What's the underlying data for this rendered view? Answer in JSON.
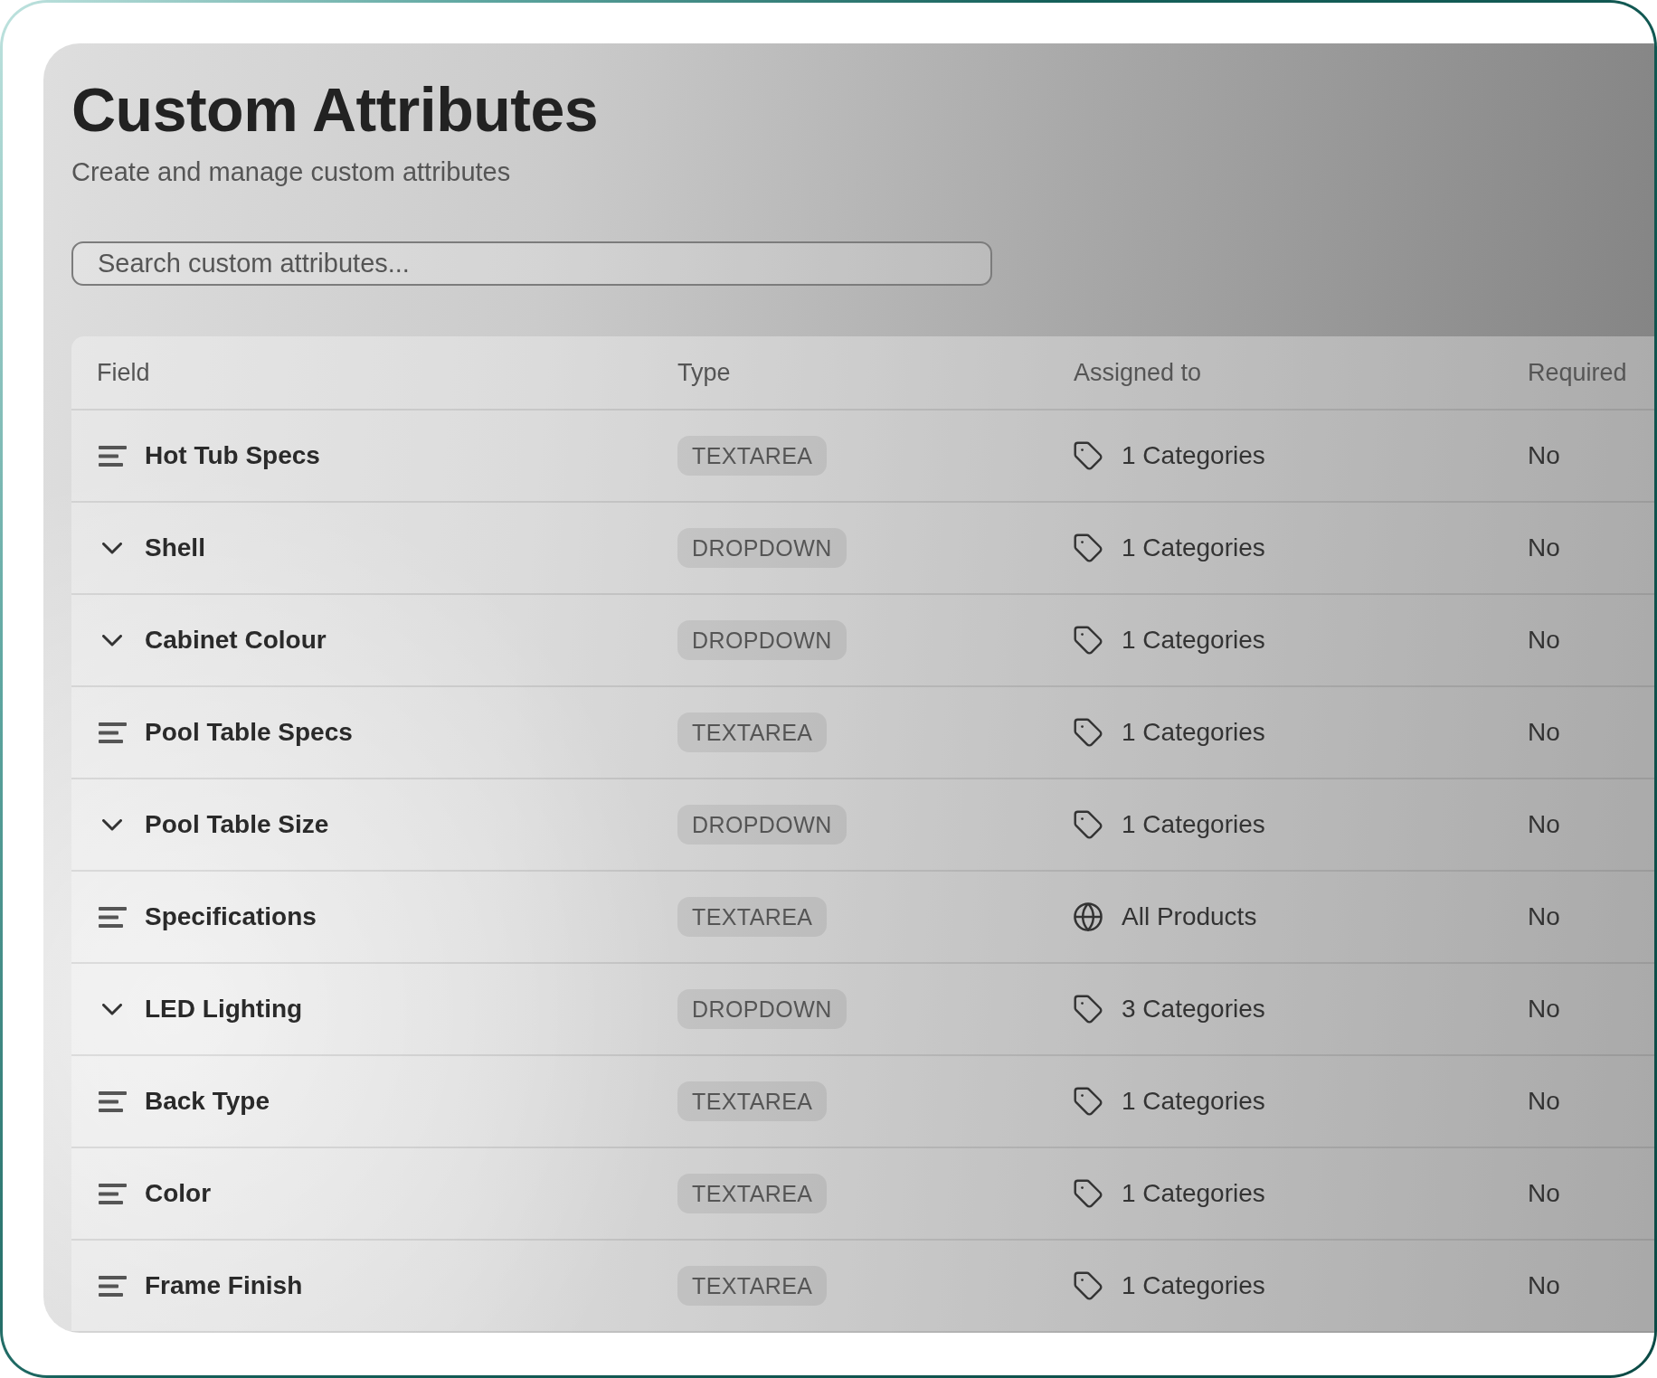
{
  "page": {
    "title": "Custom Attributes",
    "subtitle": "Create and manage custom attributes"
  },
  "search": {
    "placeholder": "Search custom attributes..."
  },
  "table": {
    "columns": [
      "Field",
      "Type",
      "Assigned to",
      "Required"
    ],
    "rows": [
      {
        "kind": "textarea",
        "field": "Hot Tub Specs",
        "type": "TEXTAREA",
        "assigned": {
          "kind": "categories",
          "text": "1 Categories"
        },
        "required": "No"
      },
      {
        "kind": "dropdown",
        "field": "Shell",
        "type": "DROPDOWN",
        "assigned": {
          "kind": "categories",
          "text": "1 Categories"
        },
        "required": "No"
      },
      {
        "kind": "dropdown",
        "field": "Cabinet Colour",
        "type": "DROPDOWN",
        "assigned": {
          "kind": "categories",
          "text": "1 Categories"
        },
        "required": "No"
      },
      {
        "kind": "textarea",
        "field": "Pool Table Specs",
        "type": "TEXTAREA",
        "assigned": {
          "kind": "categories",
          "text": "1 Categories"
        },
        "required": "No"
      },
      {
        "kind": "dropdown",
        "field": "Pool Table Size",
        "type": "DROPDOWN",
        "assigned": {
          "kind": "categories",
          "text": "1 Categories"
        },
        "required": "No"
      },
      {
        "kind": "textarea",
        "field": "Specifications",
        "type": "TEXTAREA",
        "assigned": {
          "kind": "all",
          "text": "All Products"
        },
        "required": "No"
      },
      {
        "kind": "dropdown",
        "field": "LED Lighting",
        "type": "DROPDOWN",
        "assigned": {
          "kind": "categories",
          "text": "3 Categories"
        },
        "required": "No"
      },
      {
        "kind": "textarea",
        "field": "Back Type",
        "type": "TEXTAREA",
        "assigned": {
          "kind": "categories",
          "text": "1 Categories"
        },
        "required": "No"
      },
      {
        "kind": "textarea",
        "field": "Color",
        "type": "TEXTAREA",
        "assigned": {
          "kind": "categories",
          "text": "1 Categories"
        },
        "required": "No"
      },
      {
        "kind": "textarea",
        "field": "Frame Finish",
        "type": "TEXTAREA",
        "assigned": {
          "kind": "categories",
          "text": "1 Categories"
        },
        "required": "No"
      }
    ]
  }
}
